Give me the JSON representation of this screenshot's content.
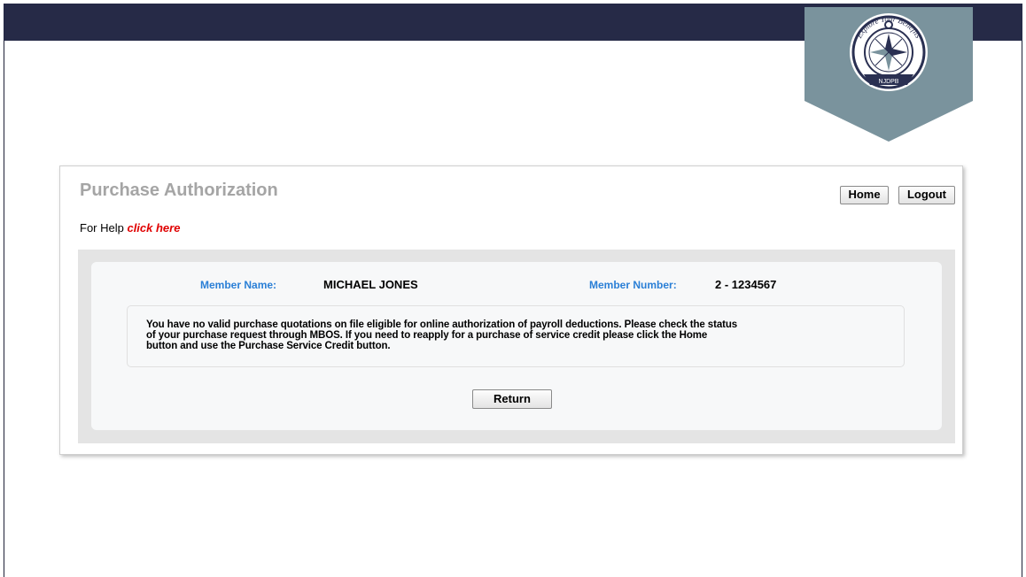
{
  "badge": {
    "text_top": "Explore Your Benefits",
    "text_bottom": "NJDPB",
    "colors": {
      "shield": "#7a939d",
      "ring": "#2a3052"
    }
  },
  "page": {
    "title": "Purchase Authorization",
    "help_prefix": "For Help ",
    "help_link": "click here",
    "home_label": "Home",
    "logout_label": "Logout"
  },
  "member": {
    "name_label": "Member Name:",
    "name": "MICHAEL JONES",
    "number_label": "Member Number:",
    "number": "2 - 1234567"
  },
  "message": {
    "line1": "You have no valid purchase quotations on file eligible for online authorization of payroll deductions. Please check the status",
    "line2": "of your purchase request through MBOS. If you need to reapply for a purchase of service credit please click the Home",
    "line3": "button and use the Purchase Service Credit button."
  },
  "return_label": "Return",
  "colors": {
    "topbar": "#262a47",
    "title": "#a5a5a5",
    "help_link": "#e00000",
    "label_blue": "#2a7fd6",
    "panel_bg": "#e4e4e4"
  }
}
